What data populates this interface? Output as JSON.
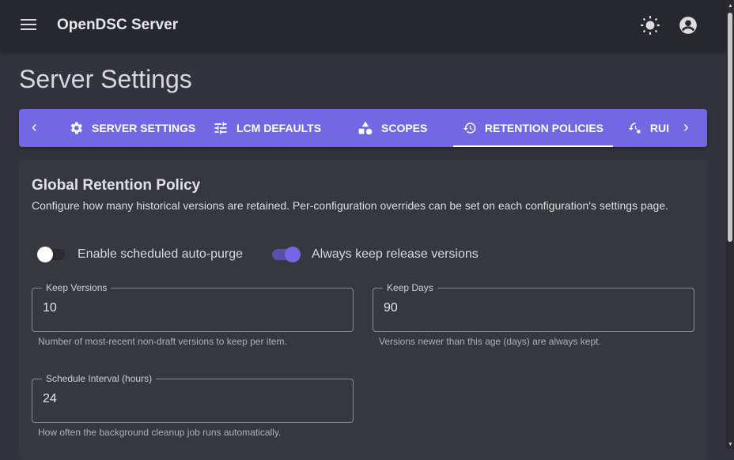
{
  "appbar": {
    "title": "OpenDSC Server",
    "icons": [
      "menu-icon",
      "theme-sun-icon",
      "account-circle-icon"
    ]
  },
  "page": {
    "title": "Server Settings"
  },
  "tabs": [
    {
      "label": "SERVER SETTINGS",
      "icon": "gear-icon"
    },
    {
      "label": "LCM DEFAULTS",
      "icon": "tune-icon"
    },
    {
      "label": "SCOPES",
      "icon": "shapes-icon"
    },
    {
      "label": "RETENTION POLICIES",
      "icon": "history-icon",
      "active": true
    },
    {
      "label": "RUI",
      "icon": "history-gear-icon"
    }
  ],
  "card": {
    "title": "Global Retention Policy",
    "description": "Configure how many historical versions are retained. Per-configuration overrides can be set on each configuration's settings page.",
    "toggles": [
      {
        "label": "Enable scheduled auto-purge",
        "checked": false
      },
      {
        "label": "Always keep release versions",
        "checked": true
      }
    ],
    "fields": [
      {
        "label": "Keep Versions",
        "value": "10",
        "help": "Number of most-recent non-draft versions to keep per item."
      },
      {
        "label": "Keep Days",
        "value": "90",
        "help": "Versions newer than this age (days) are always kept."
      },
      {
        "label": "Schedule Interval (hours)",
        "value": "24",
        "help": "How often the background cleanup job runs automatically."
      }
    ]
  },
  "colors": {
    "accent": "#7467e4",
    "appbar": "#27272f",
    "background": "#32333d",
    "card": "#373740"
  }
}
